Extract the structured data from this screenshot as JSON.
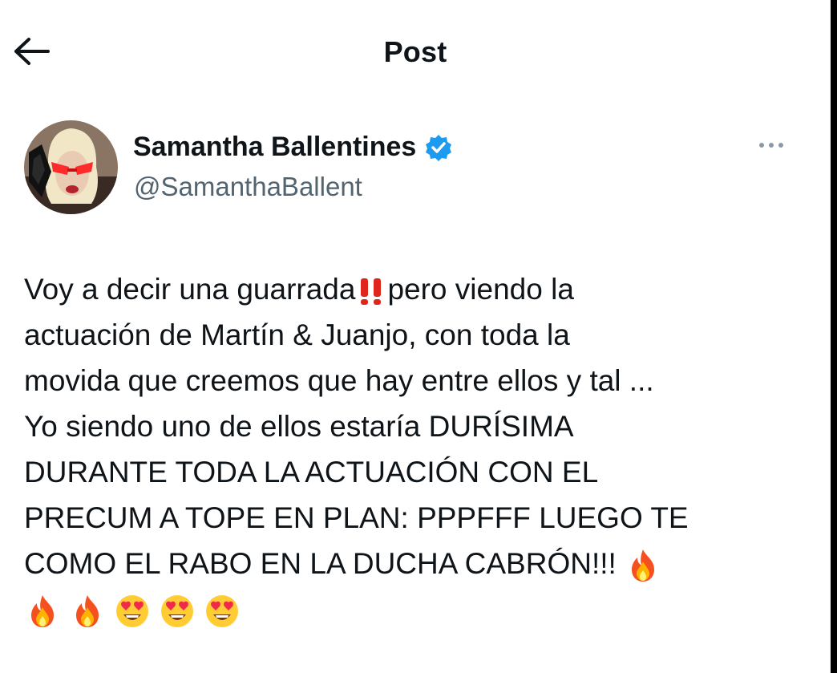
{
  "header": {
    "title": "Post",
    "back_icon": "arrow-left-icon"
  },
  "author": {
    "display_name": "Samantha Ballentines",
    "handle": "@SamanthaBallent",
    "verified": true,
    "verified_icon": "verified-badge-icon",
    "more_icon": "more-horizontal-icon"
  },
  "tweet": {
    "lines": [
      "Voy a decir una guarrada",
      "pero  viendo la",
      "actuación de Martín & Juanjo, con toda la",
      "movida que creemos que hay entre ellos y tal ...",
      "Yo siendo uno de ellos estaría DURÍSIMA",
      "DURANTE TODA LA ACTUACIÓN CON EL",
      "PRECUM A TOPE EN PLAN: PPPFFF LUEGO TE",
      "COMO EL RABO EN LA DUCHA CABRÓN!!!"
    ],
    "emojis": [
      "double-exclamation-emoji",
      "fire-emoji",
      "fire-emoji",
      "fire-emoji",
      "heart-eyes-emoji",
      "heart-eyes-emoji",
      "heart-eyes-emoji"
    ]
  },
  "colors": {
    "text": "#0f1419",
    "secondary": "#536471",
    "verified": "#1d9bf0",
    "exclamation": "#e0261c"
  }
}
